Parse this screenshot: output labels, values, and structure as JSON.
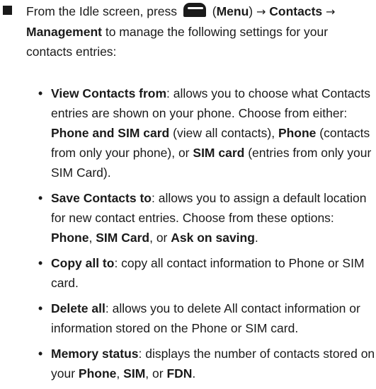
{
  "intro": {
    "pre": "From the Idle screen, press",
    "menu_open": "(",
    "menu_label": "Menu",
    "menu_close": ")",
    "arrow": "→",
    "contacts": "Contacts",
    "management": "Management",
    "post": "to manage the following settings for your contacts entries:"
  },
  "items": [
    {
      "bullet": "•",
      "term": "View Contacts from",
      "t1": ": allows you to choose what Contacts entries are shown on your phone. Choose from either:",
      "opt1": "Phone and SIM card",
      "t2": "(view all contacts),",
      "opt2": "Phone",
      "t3": "(contacts from only your phone), or",
      "opt3": "SIM card",
      "t4": "(entries from only your SIM Card)."
    },
    {
      "bullet": "•",
      "term": "Save Contacts to",
      "t1": ": allows you to assign a default location for new contact entries. Choose from these options:",
      "opt1": "Phone",
      "sep1": ",",
      "opt2": "SIM Card",
      "sep2": ", or",
      "opt3": "Ask on saving",
      "end": "."
    },
    {
      "bullet": "•",
      "term": "Copy all to",
      "t1": ": copy all contact information to Phone or SIM card."
    },
    {
      "bullet": "•",
      "term": "Delete all",
      "t1": ": allows you to delete All contact information or information stored on the Phone or SIM card."
    },
    {
      "bullet": "•",
      "term": "Memory status",
      "t1": ": displays the number of contacts stored on your",
      "opt1": "Phone",
      "sep1": ",",
      "opt2": "SIM",
      "sep2": ", or",
      "opt3": "FDN",
      "end": "."
    }
  ]
}
